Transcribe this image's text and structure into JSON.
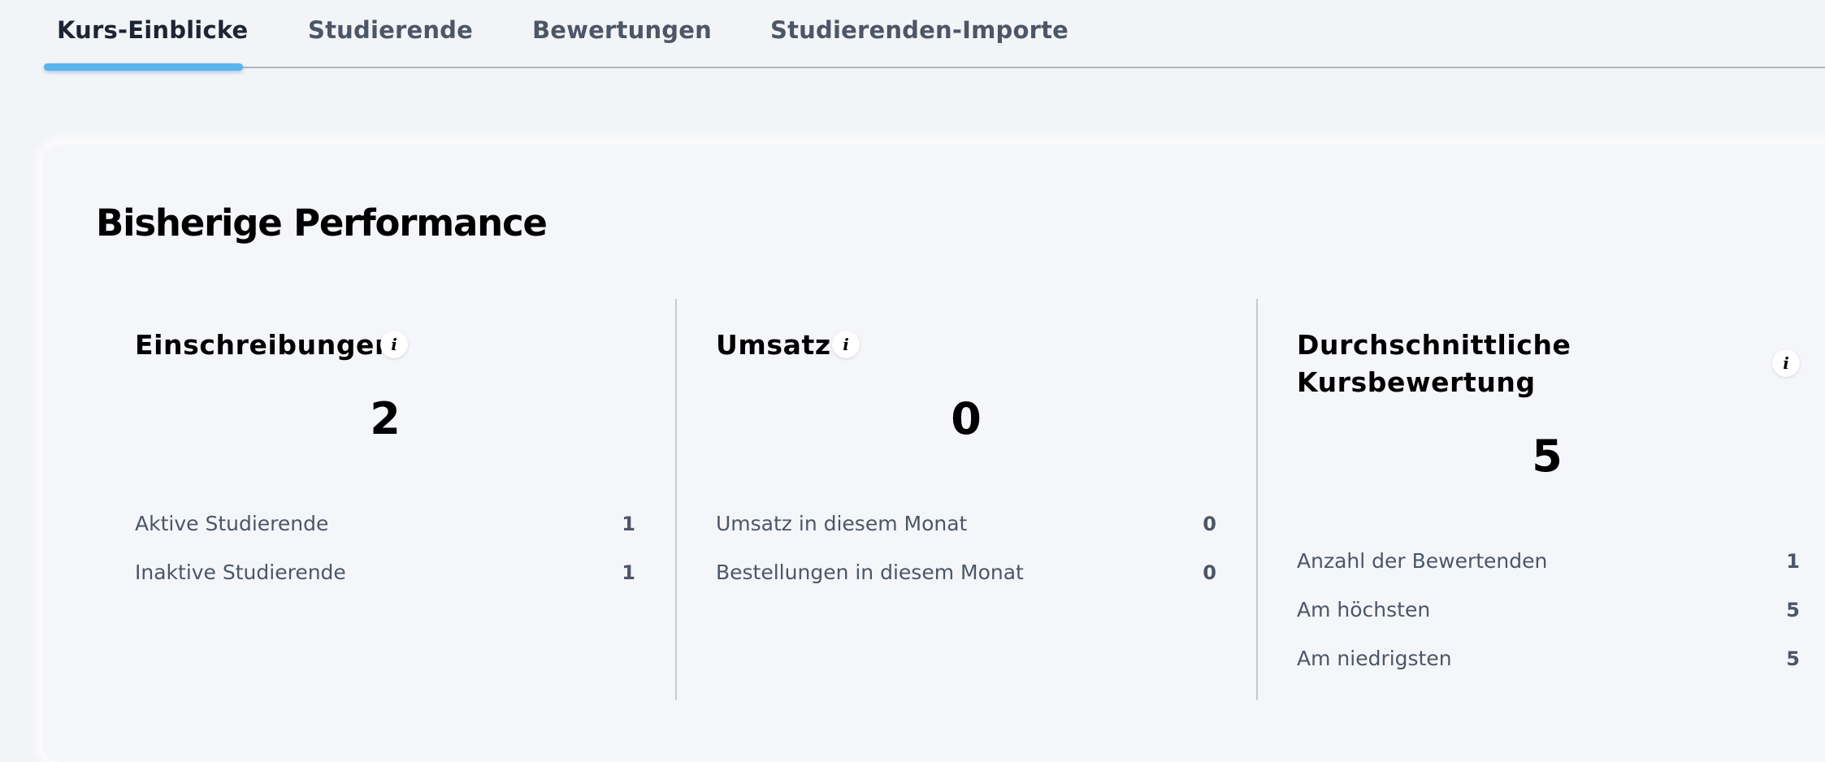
{
  "tabs": [
    {
      "label": "Kurs-Einblicke",
      "active": true
    },
    {
      "label": "Studierende",
      "active": false
    },
    {
      "label": "Bewertungen",
      "active": false
    },
    {
      "label": "Studierenden-Importe",
      "active": false
    }
  ],
  "card": {
    "title": "Bisherige Performance",
    "metrics": [
      {
        "title": "Einschreibungen",
        "info_icon": "info-icon",
        "value": "2",
        "rows": [
          {
            "label": "Aktive Studierende",
            "value": "1"
          },
          {
            "label": "Inaktive Studierende",
            "value": "1"
          }
        ]
      },
      {
        "title": "Umsatz",
        "info_icon": "info-icon",
        "value": "0",
        "rows": [
          {
            "label": "Umsatz in diesem Monat",
            "value": "0"
          },
          {
            "label": "Bestellungen in diesem Monat",
            "value": "0"
          }
        ]
      },
      {
        "title_line1": "Durchschnittliche",
        "title_line2": "Kursbewertung",
        "info_icon": "info-icon",
        "value": "5",
        "rows": [
          {
            "label": "Anzahl der Bewertenden",
            "value": "1"
          },
          {
            "label": "Am höchsten",
            "value": "5"
          },
          {
            "label": "Am niedrigsten",
            "value": "5"
          }
        ]
      }
    ]
  },
  "colors": {
    "background": "#f3f4f7",
    "tab_text": "#4c5666",
    "tab_active_text": "#1d2433",
    "tab_underline": "#5ab4ec",
    "muted_text": "#4c5666"
  }
}
